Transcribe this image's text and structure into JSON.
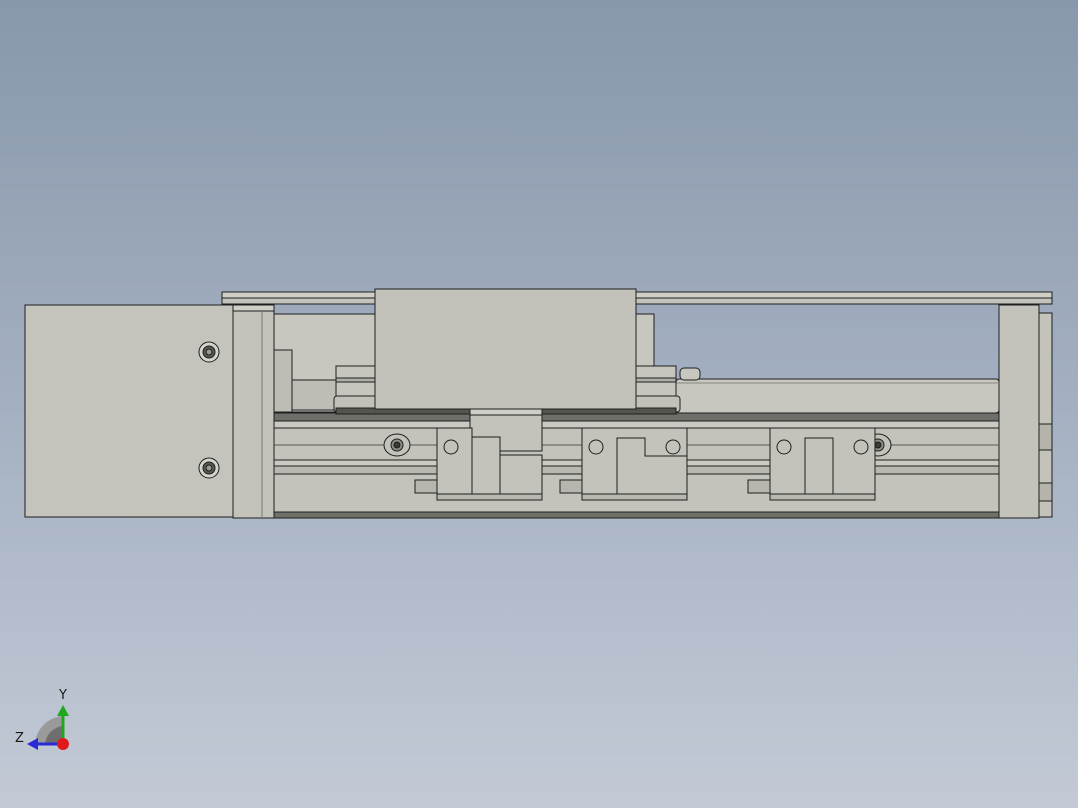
{
  "viewport": {
    "background_top": "#8897ab",
    "background_bottom": "#c3cad6"
  },
  "model": {
    "part_fill": "#c3c3bb",
    "part_edge": "#1e1e1e"
  },
  "triad": {
    "y_label": "Y",
    "z_label": "Z",
    "y_color": "#1ea81e",
    "z_color": "#2a2ad6",
    "x_color": "#e01a1a"
  }
}
